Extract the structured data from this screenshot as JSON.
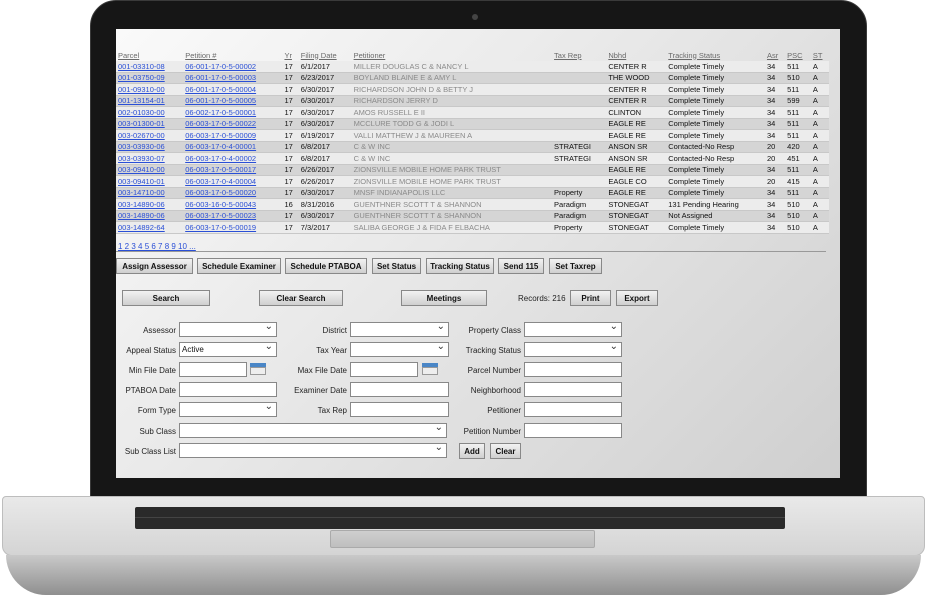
{
  "table": {
    "headers": [
      "Parcel",
      "Petition #",
      "Yr",
      "Filing Date",
      "Petitioner",
      "Tax Rep",
      "Nbhd",
      "Tracking Status",
      "Asr",
      "PSC",
      "ST"
    ],
    "rows": [
      [
        "001-03310-08",
        "06-001-17-0-5-00002",
        "17",
        "6/1/2017",
        "MILLER DOUGLAS C & NANCY L",
        "",
        "CENTER R",
        "Complete Timely",
        "34",
        "511",
        "A"
      ],
      [
        "001-03750-09",
        "06-001-17-0-5-00003",
        "17",
        "6/23/2017",
        "BOYLAND BLAINE E & AMY L",
        "",
        "THE WOOD",
        "Complete Timely",
        "34",
        "510",
        "A"
      ],
      [
        "001-09310-00",
        "06-001-17-0-5-00004",
        "17",
        "6/30/2017",
        "RICHARDSON JOHN D & BETTY J",
        "",
        "CENTER R",
        "Complete Timely",
        "34",
        "511",
        "A"
      ],
      [
        "001-13154-01",
        "06-001-17-0-5-00005",
        "17",
        "6/30/2017",
        "RICHARDSON JERRY D",
        "",
        "CENTER R",
        "Complete Timely",
        "34",
        "599",
        "A"
      ],
      [
        "002-01030-00",
        "06-002-17-0-5-00001",
        "17",
        "6/30/2017",
        "AMOS RUSSELL E II",
        "",
        "CLINTON",
        "Complete Timely",
        "34",
        "511",
        "A"
      ],
      [
        "003-01300-01",
        "06-003-17-0-5-00022",
        "17",
        "6/30/2017",
        "MCCLURE TODD G & JODI L",
        "",
        "EAGLE RE",
        "Complete Timely",
        "34",
        "511",
        "A"
      ],
      [
        "003-02670-00",
        "06-003-17-0-5-00009",
        "17",
        "6/19/2017",
        "VALLI MATTHEW J & MAUREEN A",
        "",
        "EAGLE RE",
        "Complete Timely",
        "34",
        "511",
        "A"
      ],
      [
        "003-03930-06",
        "06-003-17-0-4-00001",
        "17",
        "6/8/2017",
        "C & W INC",
        "STRATEGI",
        "ANSON SR",
        "Contacted-No Resp",
        "20",
        "420",
        "A"
      ],
      [
        "003-03930-07",
        "06-003-17-0-4-00002",
        "17",
        "6/8/2017",
        "C & W INC",
        "STRATEGI",
        "ANSON SR",
        "Contacted-No Resp",
        "20",
        "451",
        "A"
      ],
      [
        "003-09410-00",
        "06-003-17-0-5-00017",
        "17",
        "6/26/2017",
        "ZIONSVILLE MOBILE HOME PARK TRUST",
        "",
        "EAGLE RE",
        "Complete Timely",
        "34",
        "511",
        "A"
      ],
      [
        "003-09410-01",
        "06-003-17-0-4-00004",
        "17",
        "6/26/2017",
        "ZIONSVILLE MOBILE HOME PARK TRUST",
        "",
        "EAGLE CO",
        "Complete Timely",
        "20",
        "415",
        "A"
      ],
      [
        "003-14710-00",
        "06-003-17-0-5-00020",
        "17",
        "6/30/2017",
        "MNSF INDIANAPOLIS LLC",
        "Property",
        "EAGLE RE",
        "Complete Timely",
        "34",
        "511",
        "A"
      ],
      [
        "003-14890-06",
        "06-003-16-0-5-00043",
        "16",
        "8/31/2016",
        "GUENTHNER SCOTT T & SHANNON",
        "Paradigm",
        "STONEGAT",
        "131 Pending Hearing",
        "34",
        "510",
        "A"
      ],
      [
        "003-14890-06",
        "06-003-17-0-5-00023",
        "17",
        "6/30/2017",
        "GUENTHNER SCOTT T & SHANNON",
        "Paradigm",
        "STONEGAT",
        "Not Assigned",
        "34",
        "510",
        "A"
      ],
      [
        "003-14892-64",
        "06-003-17-0-5-00019",
        "17",
        "7/3/2017",
        "SALIBA GEORGE J & FIDA F ELBACHA",
        "Property",
        "STONEGAT",
        "Complete Timely",
        "34",
        "510",
        "A"
      ]
    ]
  },
  "pager": "1 2 3 4 5 6 7 8 9 10 ...",
  "actions": [
    "Assign Assessor",
    "Schedule Examiner",
    "Schedule PTABOA",
    "Set Status",
    "Tracking Status",
    "Send 115",
    "Set Taxrep"
  ],
  "search": {
    "search_label": "Search",
    "clear_label": "Clear Search",
    "meetings_label": "Meetings",
    "records_label": "Records: 216",
    "print_label": "Print",
    "export_label": "Export"
  },
  "filters": {
    "assessor": "Assessor",
    "appeal_status": "Appeal Status",
    "appeal_status_value": "Active",
    "min_file_date": "Min File Date",
    "ptaboa_date": "PTABOA Date",
    "form_type": "Form Type",
    "sub_class": "Sub Class",
    "sub_class_list": "Sub Class List",
    "district": "District",
    "tax_year": "Tax Year",
    "max_file_date": "Max File Date",
    "examiner_date": "Examiner Date",
    "tax_rep": "Tax Rep",
    "property_class": "Property Class",
    "tracking_status": "Tracking Status",
    "parcel_number": "Parcel Number",
    "neighborhood": "Neighborhood",
    "petitioner": "Petitioner",
    "petition_number": "Petition Number",
    "add_label": "Add",
    "clear_label": "Clear"
  }
}
